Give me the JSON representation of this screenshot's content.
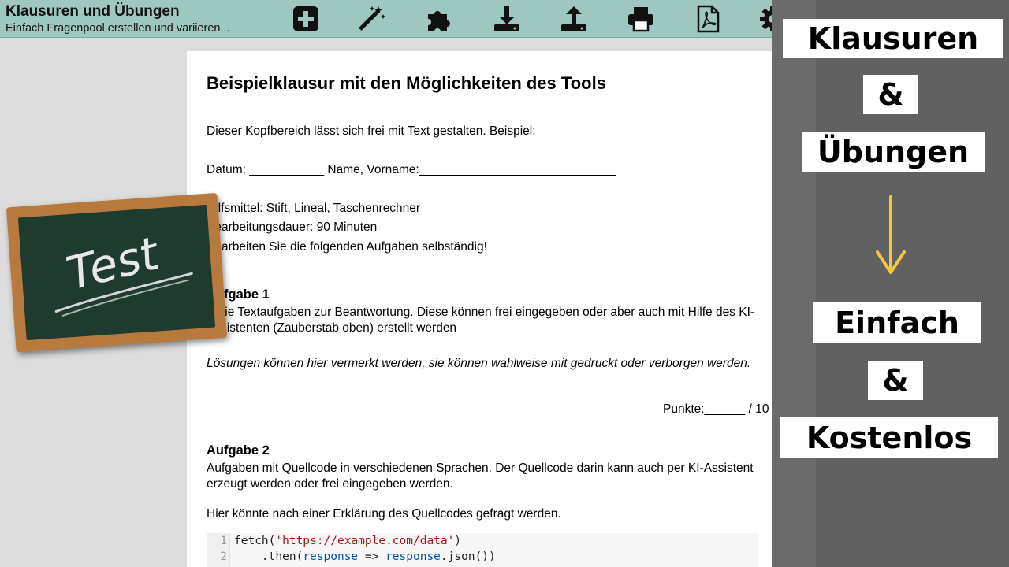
{
  "header": {
    "title": "Klausuren und Übungen",
    "subtitle": "Einfach Fragenpool erstellen und variieren..."
  },
  "toolbar_icons": [
    "add-icon",
    "magic-wand-icon",
    "puzzle-icon",
    "download-icon",
    "upload-icon",
    "print-icon",
    "pdf-icon",
    "settings-icon",
    "help-icon"
  ],
  "exam": {
    "title": "Beispielklausur mit den Möglichkeiten des Tools",
    "intro": "Dieser Kopfbereich lässt sich frei mit Text gestalten. Beispiel:",
    "fields": "Datum: ___________  Name, Vorname:_____________________________",
    "aids": "Hilfsmittel: Stift, Lineal, Taschenrechner",
    "duration": "Bearbeitungsdauer: 90 Minuten",
    "instruction": "Bearbeiten Sie die folgenden Aufgaben selbständig!",
    "task1": {
      "heading": "Aufgabe 1",
      "text_line1": "Freie Textaufgaben zur Beantwortung. Diese können frei eingegeben oder aber auch mit Hilfe des KI-",
      "text_line2": "Assistenten (Zauberstab oben) erstellt werden",
      "solution_note": "Lösungen können hier vermerkt werden, sie können wahlweise mit gedruckt oder verborgen werden.",
      "points": "Punkte:______ / 10"
    },
    "task2": {
      "heading": "Aufgabe 2",
      "text_line1": "Aufgaben mit Quellcode in verschiedenen Sprachen. Der Quellcode darin kann auch per KI-Assistent",
      "text_line2": "erzeugt werden oder frei eingegeben werden.",
      "question": "Hier könnte nach einer Erklärung des Quellcodes gefragt werden."
    },
    "code": {
      "line_numbers": [
        "1",
        "2"
      ],
      "line1_fn": "fetch(",
      "line1_str": "'https://example.com/data'",
      "line1_end": ")",
      "line2_start": "    .then(",
      "line2_var1": "response",
      "line2_arrow": " => ",
      "line2_var2": "response",
      "line2_end": ".json())"
    }
  },
  "promo": {
    "line1": "Klausuren",
    "amp1": "&",
    "line2": "Übungen",
    "arrow_color": "#f5c542",
    "line3": "Einfach",
    "amp2": "&",
    "line4": "Kostenlos"
  },
  "chalkboard": {
    "text": "Test"
  },
  "colors": {
    "toolbar": "#9ec7bf",
    "panel": "#6b6b6b",
    "board": "#1f3a2e",
    "frame": "#b77a3c"
  }
}
